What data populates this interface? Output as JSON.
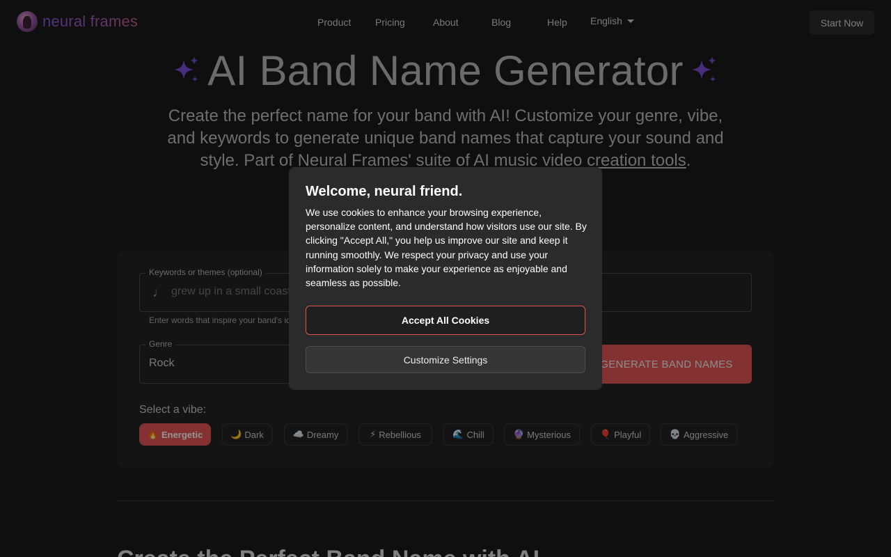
{
  "header": {
    "logo_text": "neural frames",
    "nav": [
      "Product",
      "Pricing",
      "About",
      "Blog",
      "Help"
    ],
    "language": "English",
    "cta": "Start Now"
  },
  "hero": {
    "title": "AI Band Name Generator",
    "subtitle_text": "Create the perfect name for your band with AI! Customize your genre, vibe, and keywords to generate unique band names that capture your sound and style. Part of Neural Frames' suite of AI music video ",
    "subtitle_link": "creation tools",
    "subtitle_end": "."
  },
  "form": {
    "keywords_label": "Keywords or themes (optional)",
    "keywords_placeholder": "grew up in a small coastal town",
    "keywords_helper": "Enter words that inspire your band's identity",
    "genre_label": "Genre",
    "genre_value": "Rock",
    "generate_label": "GENERATE BAND NAMES",
    "vibe_label": "Select a vibe:",
    "vibes": [
      {
        "emoji": "🔥",
        "label": "Energetic",
        "active": true
      },
      {
        "emoji": "🌙",
        "label": "Dark",
        "active": false
      },
      {
        "emoji": "☁️",
        "label": "Dreamy",
        "active": false
      },
      {
        "emoji": "⚡",
        "label": "Rebellious",
        "active": false
      },
      {
        "emoji": "🌊",
        "label": "Chill",
        "active": false
      },
      {
        "emoji": "🔮",
        "label": "Mysterious",
        "active": false
      },
      {
        "emoji": "🎈",
        "label": "Playful",
        "active": false
      },
      {
        "emoji": "💀",
        "label": "Aggressive",
        "active": false
      }
    ]
  },
  "section_title": "Create the Perfect Band Name with AI",
  "cookie_modal": {
    "title": "Welcome, neural friend.",
    "body": "We use cookies to enhance your browsing experience, personalize content, and understand how visitors use our site. By clicking \"Accept All,\" you help us improve our site and keep it running smoothly. We respect your privacy and use your information solely to make your experience as enjoyable and seamless as possible.",
    "accept_label": "Accept All Cookies",
    "customize_label": "Customize Settings"
  },
  "colors": {
    "accent": "#e25555",
    "background": "#1b1b1b",
    "sparkle": "#7b4fd6"
  }
}
